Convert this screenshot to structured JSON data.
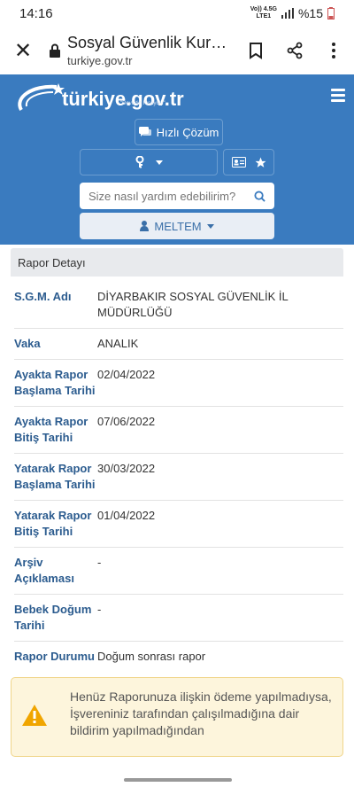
{
  "status": {
    "time": "14:16",
    "network_top": "Vo)) 4.5G",
    "network_bottom": "LTE1",
    "battery": "%15"
  },
  "browser": {
    "title": "Sosyal Güvenlik Kurum...",
    "url": "turkiye.gov.tr"
  },
  "header": {
    "logo_text": "türkiye.gov.tr",
    "logo_subtitle": "\"Devletin Kısayolu\"",
    "quick_label": "Hızlı Çözüm",
    "search_placeholder": "Size nasıl yardım edebilirim?",
    "user_name": "MELTEM"
  },
  "panel": {
    "title": "Rapor Detayı"
  },
  "rows": [
    {
      "label": "S.G.M. Adı",
      "value": "DİYARBAKIR SOSYAL GÜVENLİK İL MÜDÜRLÜĞÜ"
    },
    {
      "label": "Vaka",
      "value": "ANALIK"
    },
    {
      "label": "Ayakta Rapor Başlama Tarihi",
      "value": "02/04/2022"
    },
    {
      "label": "Ayakta Rapor Bitiş Tarihi",
      "value": "07/06/2022"
    },
    {
      "label": "Yatarak Rapor Başlama Tarihi",
      "value": "30/03/2022"
    },
    {
      "label": "Yatarak Rapor Bitiş Tarihi",
      "value": "01/04/2022"
    },
    {
      "label": "Arşiv Açıklaması",
      "value": "-"
    },
    {
      "label": "Bebek Doğum Tarihi",
      "value": "-"
    },
    {
      "label": "Rapor Durumu",
      "value": "Doğum sonrası rapor"
    }
  ],
  "alert": {
    "text": "Henüz Raporunuza ilişkin ödeme yapılmadıysa, İşvereniniz tarafından çalışılmadığına dair bildirim yapılmadığından"
  },
  "colors": {
    "header_bg": "#3a7bbf",
    "label": "#2c5c8f",
    "alert_bg": "#fdf5dc",
    "alert_icon": "#f0a500"
  }
}
